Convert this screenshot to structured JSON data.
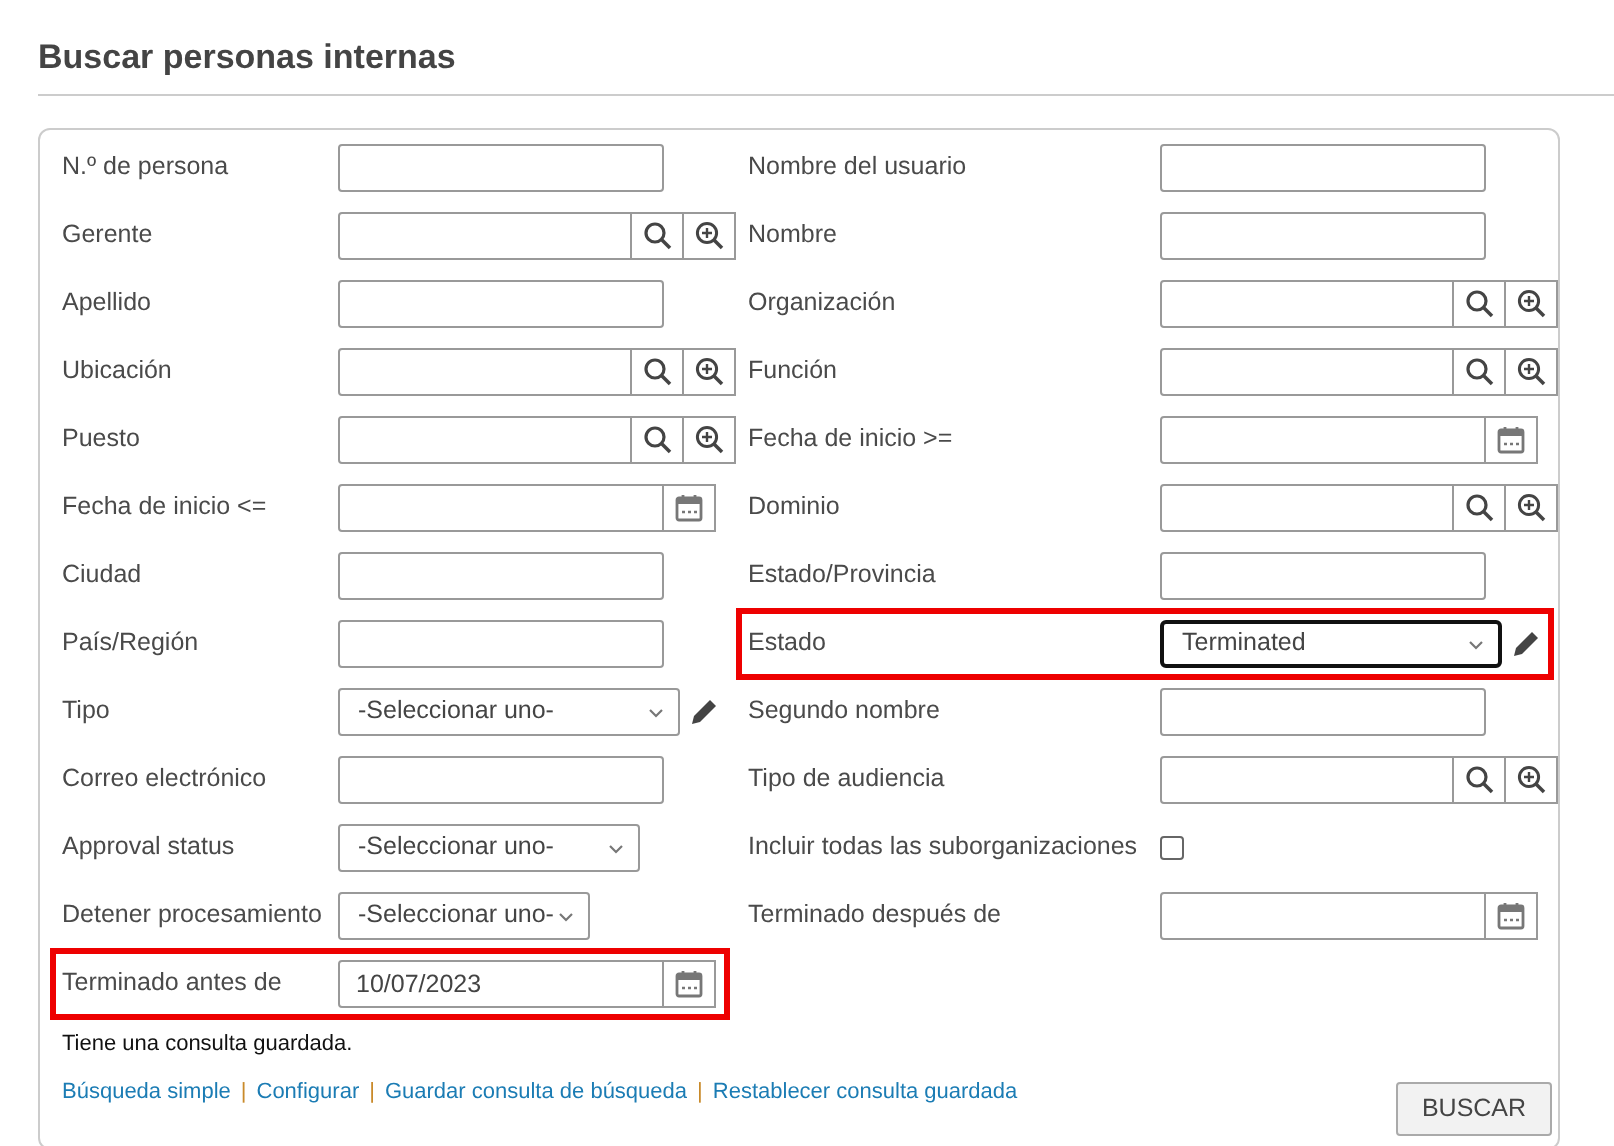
{
  "title": "Buscar personas internas",
  "left": [
    {
      "label": "N.º de persona",
      "kind": "text"
    },
    {
      "label": "Gerente",
      "kind": "lookup"
    },
    {
      "label": "Apellido",
      "kind": "text"
    },
    {
      "label": "Ubicación",
      "kind": "lookup"
    },
    {
      "label": "Puesto",
      "kind": "lookup"
    },
    {
      "label": "Fecha de inicio <=",
      "kind": "date"
    },
    {
      "label": "Ciudad",
      "kind": "text"
    },
    {
      "label": "País/Región",
      "kind": "text"
    },
    {
      "label": "Tipo",
      "kind": "select-edit",
      "value": "-Seleccionar uno-"
    },
    {
      "label": "Correo electrónico",
      "kind": "text"
    },
    {
      "label": "Approval status",
      "kind": "select",
      "value": "-Seleccionar uno-"
    },
    {
      "label": "Detener procesamiento",
      "kind": "select-narrow",
      "value": "-Seleccionar uno-"
    },
    {
      "label": "Terminado antes de",
      "kind": "date",
      "value": "10/07/2023",
      "highlighted": true
    }
  ],
  "right": [
    {
      "label": "Nombre del usuario",
      "kind": "text"
    },
    {
      "label": "Nombre",
      "kind": "text"
    },
    {
      "label": "Organización",
      "kind": "lookup"
    },
    {
      "label": "Función",
      "kind": "lookup"
    },
    {
      "label": "Fecha de inicio >=",
      "kind": "date"
    },
    {
      "label": "Dominio",
      "kind": "lookup"
    },
    {
      "label": "Estado/Provincia",
      "kind": "text"
    },
    {
      "label": "Estado",
      "kind": "select-edit",
      "value": "Terminated",
      "highlighted": true,
      "focused": true
    },
    {
      "label": "Segundo nombre",
      "kind": "text"
    },
    {
      "label": "Tipo de audiencia",
      "kind": "lookup"
    },
    {
      "label": "Incluir todas las suborganizaciones",
      "kind": "checkbox",
      "checked": false
    },
    {
      "label": "Terminado después de",
      "kind": "date"
    }
  ],
  "note": "Tiene una consulta guardada.",
  "links": [
    {
      "label": "Búsqueda simple"
    },
    {
      "label": "Configurar",
      "separator": "|"
    },
    {
      "label": "Guardar consulta de búsqueda",
      "separator": "|"
    },
    {
      "label": "Restablecer consulta guardada",
      "separator": "|"
    }
  ],
  "search_button": "BUSCAR"
}
